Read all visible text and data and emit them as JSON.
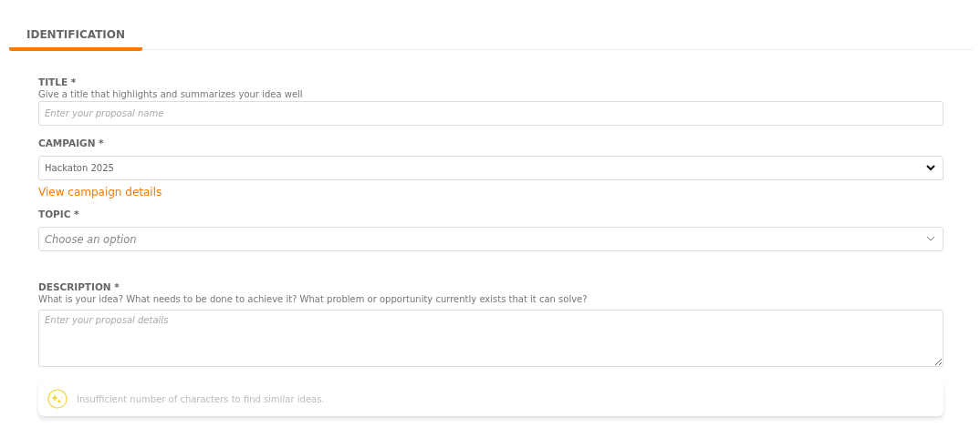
{
  "tabs": [
    {
      "label": "IDENTIFICATION",
      "selected": true
    }
  ],
  "fields": [
    {
      "kind": "text",
      "label": "TITLE *",
      "hint": "Give a title that highlights and summarizes your idea well",
      "placeholder": "Enter your proposal name"
    },
    {
      "kind": "select",
      "label": "CAMPAIGN *",
      "value": "Hackaton 2025",
      "link": "View campaign details"
    },
    {
      "kind": "select",
      "label": "TOPIC *",
      "placeholder": "Choose an option"
    },
    {
      "kind": "textarea",
      "label": "DESCRIPTION *",
      "hint": "What is your idea? What needs to be done to achieve it? What problem or opportunity currently exists that it can solve?",
      "placeholder": "Enter your proposal details"
    }
  ],
  "notice": {
    "text": "Insufficient number of characters to find similar ideas."
  }
}
